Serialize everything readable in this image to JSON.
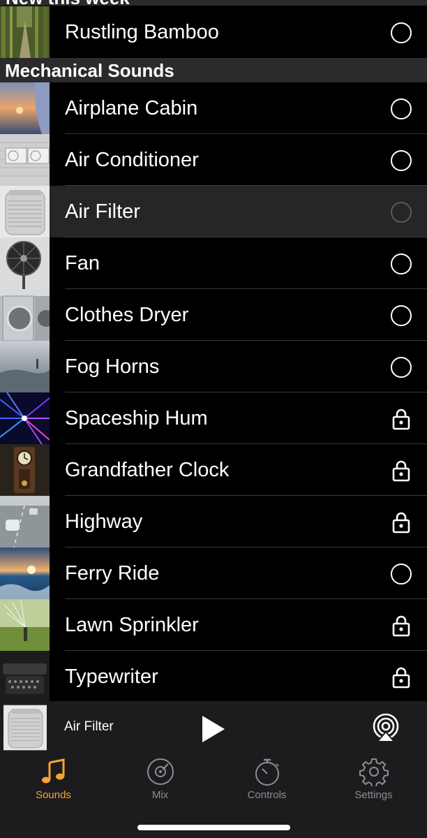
{
  "top_section": {
    "title": "New this week"
  },
  "section": {
    "title": "Mechanical Sounds"
  },
  "rows": [
    {
      "label": "Rustling Bamboo",
      "status": "circle"
    },
    {
      "label": "Airplane Cabin",
      "status": "circle"
    },
    {
      "label": "Air Conditioner",
      "status": "circle"
    },
    {
      "label": "Air Filter",
      "status": "circle-selected"
    },
    {
      "label": "Fan",
      "status": "circle"
    },
    {
      "label": "Clothes Dryer",
      "status": "circle"
    },
    {
      "label": "Fog Horns",
      "status": "circle"
    },
    {
      "label": "Spaceship Hum",
      "status": "lock"
    },
    {
      "label": "Grandfather Clock",
      "status": "lock"
    },
    {
      "label": "Highway",
      "status": "lock"
    },
    {
      "label": "Ferry Ride",
      "status": "circle"
    },
    {
      "label": "Lawn Sprinkler",
      "status": "lock"
    },
    {
      "label": "Typewriter",
      "status": "lock"
    }
  ],
  "player": {
    "title": "Air Filter",
    "state": "paused"
  },
  "tabs": [
    {
      "label": "Sounds",
      "icon": "music-note-icon",
      "active": true
    },
    {
      "label": "Mix",
      "icon": "disc-icon",
      "active": false
    },
    {
      "label": "Controls",
      "icon": "stopwatch-icon",
      "active": false
    },
    {
      "label": "Settings",
      "icon": "gear-icon",
      "active": false
    }
  ],
  "colors": {
    "accent": "#f3a534",
    "inactive": "#8e8e93",
    "background": "#000000",
    "bar": "#1c1c1e"
  }
}
